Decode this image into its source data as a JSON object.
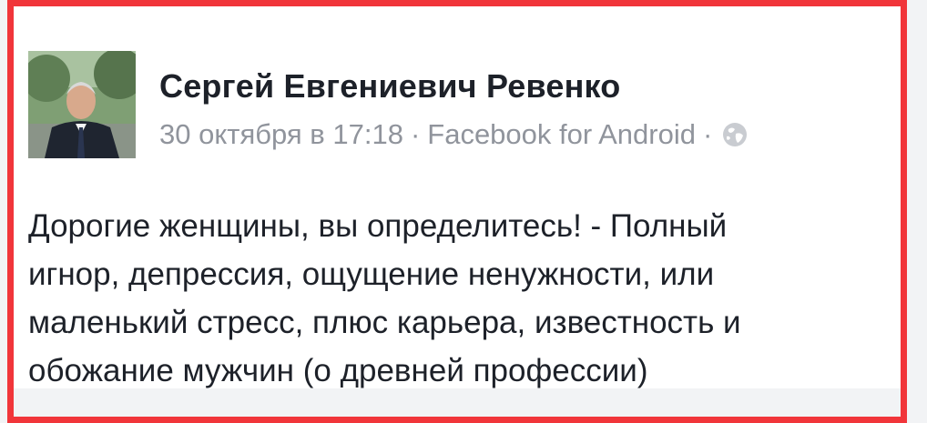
{
  "post": {
    "author": "Сергей Евгениевич Ревенко",
    "date": "30 октября в 17:18",
    "separator": "·",
    "source": "Facebook for Android",
    "privacy_icon": "globe-icon",
    "text": "Дорогие женщины, вы определитесь! - Полный\nигнор, депрессия, ощущение ненужности, или\nмаленький стресс, плюс карьера, известность и\nобожание мужчин (о древней профессии)"
  },
  "colors": {
    "highlight_border": "#f1353a",
    "author_text": "#1d2129",
    "meta_text": "#90949c",
    "page_background": "#f2f3f5"
  }
}
